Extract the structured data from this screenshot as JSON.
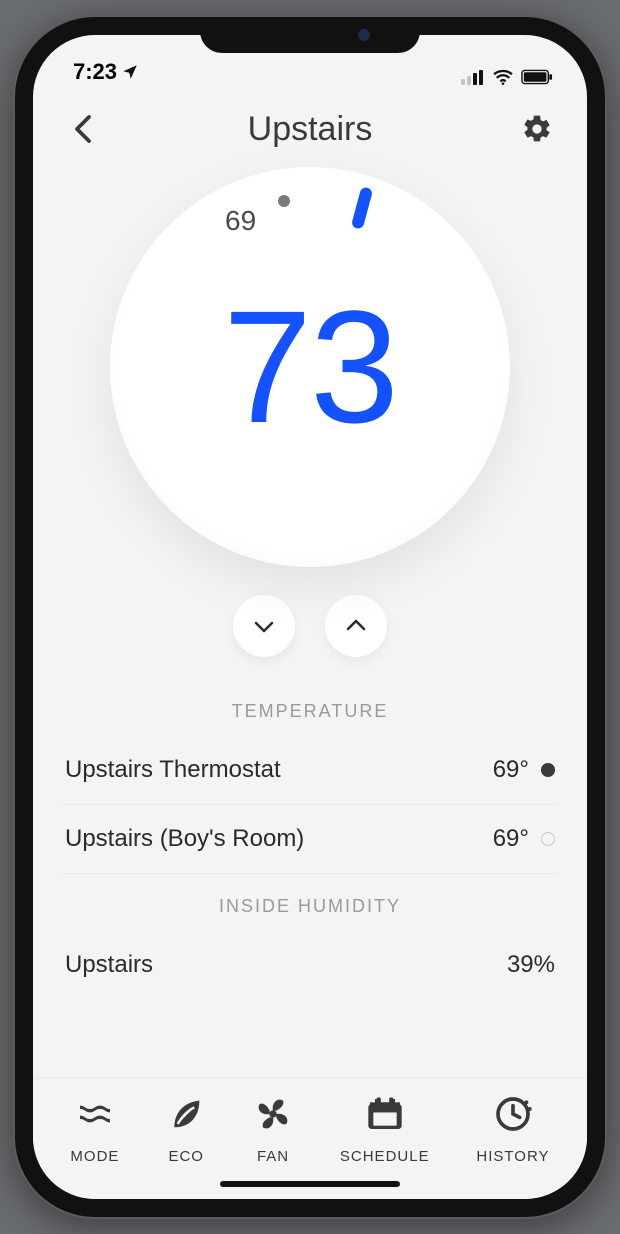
{
  "status": {
    "time": "7:23"
  },
  "header": {
    "title": "Upstairs"
  },
  "thermostat": {
    "set_point": "73",
    "ambient_label": "69"
  },
  "temperature": {
    "section_label": "TEMPERATURE",
    "sensors": [
      {
        "name": "Upstairs Thermostat",
        "value": "69°",
        "active": true
      },
      {
        "name": "Upstairs (Boy's Room)",
        "value": "69°",
        "active": false
      }
    ]
  },
  "humidity": {
    "section_label": "INSIDE HUMIDITY",
    "rows": [
      {
        "name": "Upstairs",
        "value": "39%"
      }
    ]
  },
  "tabs": [
    {
      "key": "mode",
      "label": "MODE"
    },
    {
      "key": "eco",
      "label": "ECO"
    },
    {
      "key": "fan",
      "label": "FAN"
    },
    {
      "key": "schedule",
      "label": "SCHEDULE"
    },
    {
      "key": "history",
      "label": "HISTORY"
    }
  ]
}
